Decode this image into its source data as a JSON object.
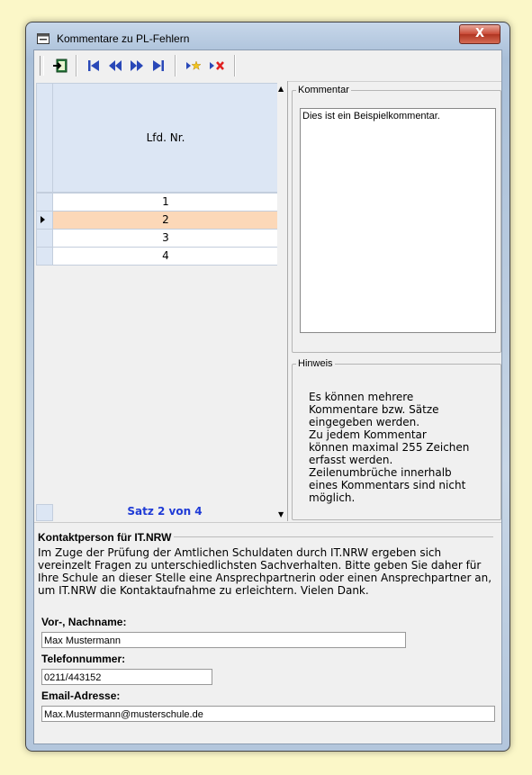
{
  "window": {
    "title": "Kommentare zu  PL-Fehlern",
    "close_glyph": "X"
  },
  "toolbar": {
    "buttons": [
      "exit-icon",
      "first-record-icon",
      "previous-record-icon",
      "next-record-icon",
      "last-record-icon",
      "new-record-icon",
      "delete-record-icon"
    ]
  },
  "grid": {
    "column_header": "Lfd. Nr.",
    "rows": [
      "1",
      "2",
      "3",
      "4"
    ],
    "active_row_index": 1,
    "status": "Satz 2 von 4"
  },
  "kommentar": {
    "legend": "Kommentar",
    "text": "Dies ist ein Beispielkommentar."
  },
  "hinweis": {
    "legend": "Hinweis",
    "text": "Es können mehrere\nKommentare bzw. Sätze\neingegeben werden.\nZu jedem Kommentar\nkönnen maximal 255 Zeichen\nerfasst werden.\nZeilenumbrüche innerhalb\neines Kommentars sind nicht\nmöglich."
  },
  "contact": {
    "title": "Kontaktperson für IT.NRW",
    "description": "Im Zuge der Prüfung der Amtlichen Schuldaten durch IT.NRW ergeben sich vereinzelt Fragen zu unterschiedlichsten Sachverhalten. Bitte geben Sie daher für Ihre Schule an dieser Stelle eine Ansprechpartnerin oder einen Ansprechpartner an, um IT.NRW die Kontaktaufnahme zu erleichtern. Vielen Dank.",
    "name_label": "Vor-, Nachname:",
    "name_value": "Max Mustermann",
    "phone_label": "Telefonnummer:",
    "phone_value": "0211/443152",
    "email_label": "Email-Adresse:",
    "email_value": "Max.Mustermann@musterschule.de"
  },
  "colors": {
    "active_row": "#fcd8b8",
    "status_text": "#1f3bd6",
    "header_bg": "#dce6f4"
  }
}
